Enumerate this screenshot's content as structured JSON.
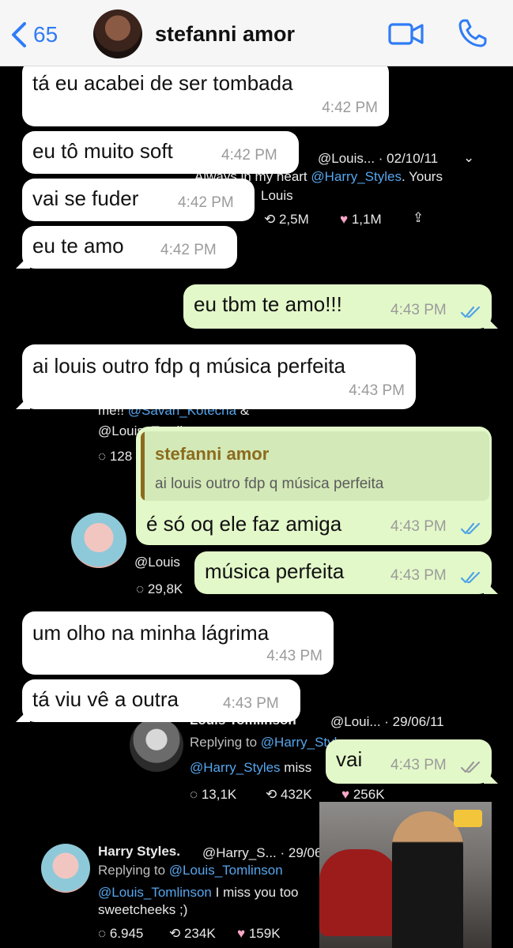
{
  "header": {
    "back_count": "65",
    "contact_name": "stefanni amor"
  },
  "background_tweets": {
    "tweet1_header": "@Louis... · 02/10/11",
    "tweet1_text_a": "Always in my heart",
    "tweet1_link": "@Harry_Styles",
    "tweet1_text_b": ". Yours",
    "tweet1_text_c": "Louis",
    "tweet1_retweets": "2,5M",
    "tweet1_likes": "1,1M",
    "tweet2_line1_a": "me!!",
    "tweet2_line1_link": "@Savan_Kotecha",
    "tweet2_line1_b": "&",
    "tweet2_line2_link": "@Louis_Tomlinson",
    "tweet2_replies": "128",
    "tweet2_handle": "@Louis",
    "tweet2_count": "29,8K",
    "tweet3_author": "Louis Tomlinson",
    "tweet3_header": "@Loui... · 29/06/11",
    "tweet3_replying_label": "Replying to",
    "tweet3_replying_link": "@Harry_Styles",
    "tweet3_text_link": "@Harry_Styles",
    "tweet3_text": "miss",
    "tweet3_replies": "13,1K",
    "tweet3_retweets": "432K",
    "tweet3_likes": "256K",
    "tweet4_author": "Harry Styles.",
    "tweet4_header": "@Harry_S... · 29/06",
    "tweet4_replying_label": "Replying to",
    "tweet4_replying_link": "@Louis_Tomlinson",
    "tweet4_text_link": "@Louis_Tomlinson",
    "tweet4_text_a": "I miss you too",
    "tweet4_text_b": "sweetcheeks ;)",
    "tweet4_replies": "6.945",
    "tweet4_retweets": "234K",
    "tweet4_likes": "159K"
  },
  "messages": [
    {
      "text": "tá eu acabei de ser tombada",
      "time": "4:42 PM",
      "direction": "in"
    },
    {
      "text": "eu tô muito soft",
      "time": "4:42 PM",
      "direction": "in"
    },
    {
      "text": "vai se fuder",
      "time": "4:42 PM",
      "direction": "in"
    },
    {
      "text": "eu te amo",
      "time": "4:42 PM",
      "direction": "in"
    },
    {
      "text": "eu tbm te amo!!!",
      "time": "4:43 PM",
      "direction": "out",
      "status": "read"
    },
    {
      "text": "ai louis outro fdp q música perfeita",
      "time": "4:43 PM",
      "direction": "in"
    },
    {
      "text": "é só oq ele faz amiga",
      "time": "4:43 PM",
      "direction": "out",
      "status": "read",
      "quote": {
        "name": "stefanni amor",
        "text": "ai louis outro fdp q música perfeita"
      }
    },
    {
      "text": "música perfeita",
      "time": "4:43 PM",
      "direction": "out",
      "status": "read"
    },
    {
      "text": "um olho na minha lágrima",
      "time": "4:43 PM",
      "direction": "in"
    },
    {
      "text": "tá viu vê a outra",
      "time": "4:43 PM",
      "direction": "in"
    },
    {
      "text": "vai",
      "time": "4:43 PM",
      "direction": "out",
      "status": "delivered"
    }
  ],
  "colors": {
    "accent": "#2f7cf6",
    "incoming_bubble": "#ffffff",
    "outgoing_bubble": "#e3f8c9",
    "read_ticks": "#4fa3e6",
    "delivered_ticks": "#9b9b9b",
    "quote_name": "#8c6b1e"
  }
}
